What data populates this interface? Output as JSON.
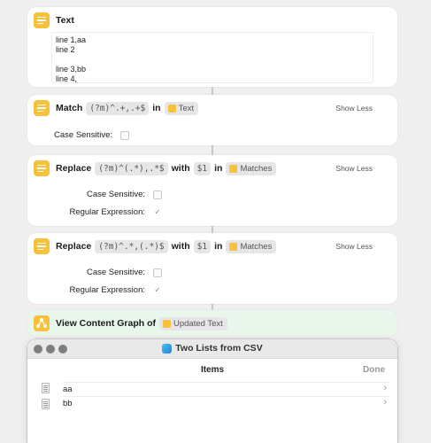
{
  "actions": {
    "text": {
      "title": "Text",
      "lines": [
        "line 1,aa",
        "line 2",
        "",
        "line 3,bb",
        "line 4,"
      ]
    },
    "match": {
      "label": "Match",
      "pattern": "(?m)^.+,.+$",
      "in_label": "in",
      "input_var": "Text",
      "show_less": "Show Less",
      "case_sensitive_label": "Case Sensitive:"
    },
    "replace1": {
      "label": "Replace",
      "pattern": "(?m)^(.*),.*$",
      "with_label": "with",
      "replacement": "$1",
      "in_label": "in",
      "input_var": "Matches",
      "show_less": "Show Less",
      "case_sensitive_label": "Case Sensitive:",
      "regex_label": "Regular Expression:",
      "regex_checked_glyph": "✓"
    },
    "replace2": {
      "label": "Replace",
      "pattern": "(?m)^.*,(.*)$",
      "with_label": "with",
      "replacement": "$1",
      "in_label": "in",
      "input_var": "Matches",
      "show_less": "Show Less",
      "case_sensitive_label": "Case Sensitive:",
      "regex_label": "Regular Expression:",
      "regex_checked_glyph": "✓"
    },
    "graph": {
      "label": "View Content Graph of",
      "input_var": "Updated Text"
    }
  },
  "window": {
    "title": "Two Lists from CSV",
    "list_title": "Items",
    "done_label": "Done",
    "items": [
      {
        "label": "aa",
        "chevron": "›"
      },
      {
        "label": "bb",
        "chevron": "›"
      }
    ]
  },
  "colors": {
    "action_icon": "#f7c23b",
    "graph_card_bg": "#e9f6ec",
    "page_bg": "#efefef"
  }
}
